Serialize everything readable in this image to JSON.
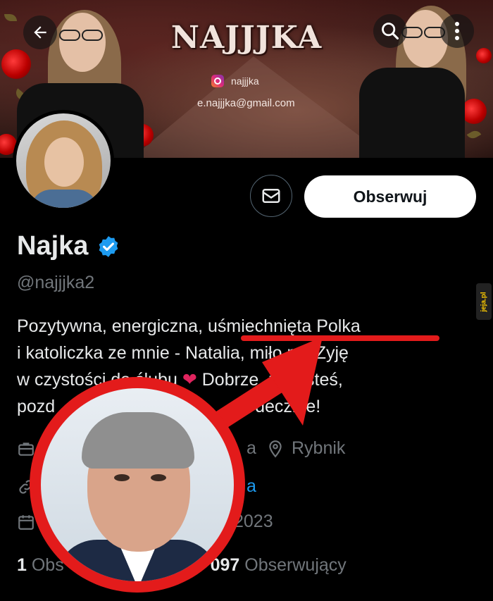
{
  "banner": {
    "title": "NAJJJKA",
    "instagram_handle": "najjjka",
    "email": "e.najjjka@gmail.com"
  },
  "icons": {
    "back": "arrow-left-icon",
    "search": "search-icon",
    "more": "more-vertical-icon",
    "message": "mail-icon",
    "verified": "verified-badge-icon",
    "work": "briefcase-icon",
    "location": "location-pin-icon",
    "link": "link-icon",
    "calendar": "calendar-icon"
  },
  "colors": {
    "accent": "#1d9bf0",
    "annotation_red": "#e31b1b",
    "background": "#000000"
  },
  "profile": {
    "follow_label": "Obserwuj",
    "display_name": "Najka",
    "handle": "@najjjka2",
    "bio_lines": [
      "Pozytywna, energiczna, uśmiechnięta Polka",
      "i katoliczka ze mnie - Natalia, miło mi. Zyję",
      "w czystości do ślubu",
      "Dobrze, że jesteś,",
      "pozd",
      "decznie!"
    ],
    "work_partial": "a",
    "location": "Rybnik",
    "link_partial": "a",
    "joined_partial": "2023",
    "following_count": "1",
    "following_label_partial": "Obs",
    "followers_count_partial": "097",
    "followers_label": "Obserwujący"
  },
  "watermark": "jeja.pl"
}
